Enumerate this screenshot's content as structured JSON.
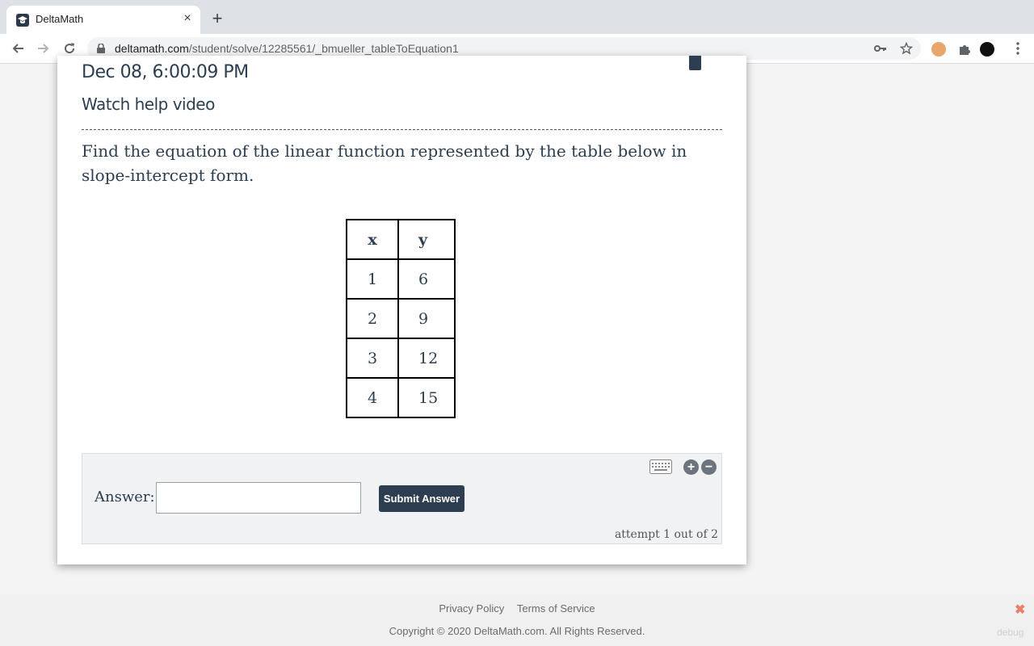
{
  "browser": {
    "tab_title": "DeltaMath",
    "tab_close": "×",
    "new_tab": "+",
    "url_host": "deltamath.com",
    "url_path": "/student/solve/12285561/_bmueller_tableToEquation1",
    "icons": [
      "back-icon",
      "forward-icon",
      "reload-icon",
      "lock-icon",
      "key-icon",
      "star-icon",
      "extension-icon",
      "profile-avatar",
      "menu-icon"
    ]
  },
  "assignment": {
    "due_date": "Dec 08, 6:00:09 PM",
    "help_link": "Watch help video"
  },
  "question": {
    "text": "Find the equation of the linear function represented by the table below in slope-intercept form.",
    "table": {
      "headers": [
        "x",
        "y"
      ],
      "rows": [
        [
          "1",
          "6"
        ],
        [
          "2",
          "9"
        ],
        [
          "3",
          "12"
        ],
        [
          "4",
          "15"
        ]
      ]
    }
  },
  "answer": {
    "label": "Answer:",
    "value": "",
    "submit_label": "Submit Answer",
    "attempt_text": "attempt 1 out of 2",
    "zoom_in": "+",
    "zoom_out": "−"
  },
  "footer": {
    "privacy": "Privacy Policy",
    "terms": "Terms of Service",
    "copyright": "Copyright © 2020 DeltaMath.com. All Rights Reserved.",
    "debug_close": "✖",
    "debug": "debug"
  },
  "colors": {
    "brand_dark": "#2c3e50",
    "panel_bg": "#f0f2f4",
    "page_bg": "#f4f4f4"
  }
}
